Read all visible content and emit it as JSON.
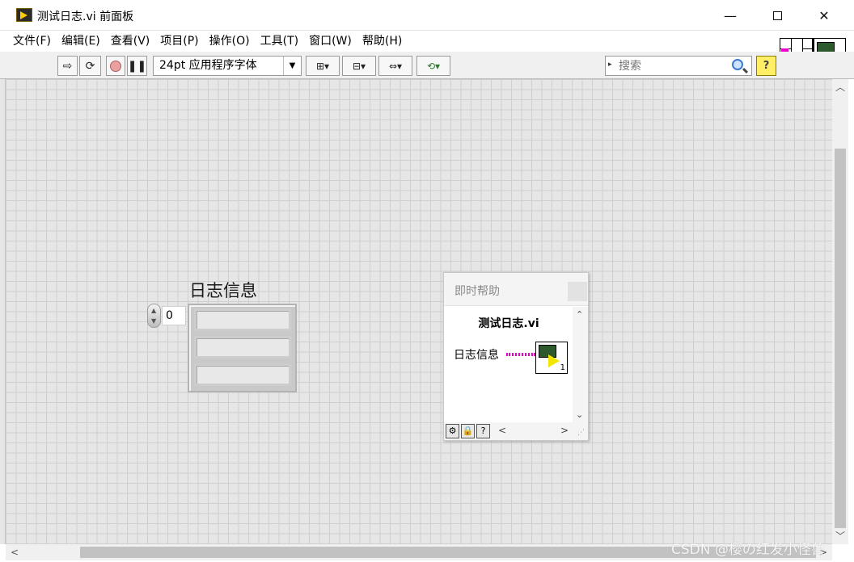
{
  "window": {
    "title": "测试日志.vi 前面板",
    "minimize_glyph": "—",
    "close_glyph": "✕"
  },
  "menu": {
    "items": [
      "文件(F)",
      "编辑(E)",
      "查看(V)",
      "项目(P)",
      "操作(O)",
      "工具(T)",
      "窗口(W)",
      "帮助(H)"
    ]
  },
  "toolbar": {
    "font_select": "24pt 应用程序字体",
    "search": {
      "placeholder": "搜索"
    },
    "help_glyph": "?",
    "icons": [
      "run-arrow-icon",
      "run-continuously-icon",
      "abort-icon",
      "pause-icon",
      "align-objects-icon",
      "distribute-objects-icon",
      "resize-objects-icon",
      "reorder-icon"
    ]
  },
  "vi_icon": {
    "number": "1"
  },
  "front_panel": {
    "array": {
      "label": "日志信息",
      "index_value": "0",
      "element_count": 3
    }
  },
  "context_help": {
    "title": "即时帮助",
    "vi_name": "测试日志.vi",
    "terminal_label": "日志信息",
    "icon_number": "1",
    "wire_color": "#ee00cc"
  },
  "watermark": "CSDN @樱の红发小怪兽"
}
